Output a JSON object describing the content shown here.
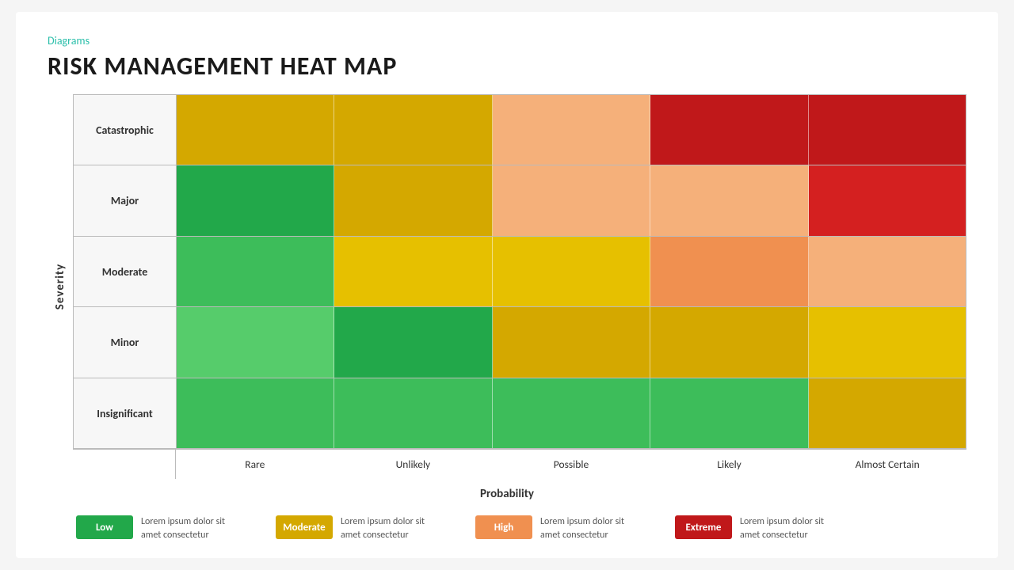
{
  "header": {
    "diagrams_label": "Diagrams",
    "title": "RISK MANAGEMENT HEAT MAP"
  },
  "matrix": {
    "severity_label": "Severity",
    "probability_label": "Probability",
    "rows": [
      {
        "label": "Catastrophic",
        "cells": [
          {
            "color": "c-yellow"
          },
          {
            "color": "c-yellow"
          },
          {
            "color": "c-orange-light"
          },
          {
            "color": "c-red-dark"
          },
          {
            "color": "c-red-dark"
          }
        ]
      },
      {
        "label": "Major",
        "cells": [
          {
            "color": "c-green-dark"
          },
          {
            "color": "c-yellow"
          },
          {
            "color": "c-orange-light"
          },
          {
            "color": "c-orange-light"
          },
          {
            "color": "c-red"
          }
        ]
      },
      {
        "label": "Moderate",
        "cells": [
          {
            "color": "c-green-mid"
          },
          {
            "color": "c-yellow-light"
          },
          {
            "color": "c-yellow-light"
          },
          {
            "color": "c-orange"
          },
          {
            "color": "c-orange-light"
          }
        ]
      },
      {
        "label": "Minor",
        "cells": [
          {
            "color": "c-green-light"
          },
          {
            "color": "c-green-dark"
          },
          {
            "color": "c-yellow"
          },
          {
            "color": "c-yellow"
          },
          {
            "color": "c-yellow-light"
          }
        ]
      },
      {
        "label": "Insignificant",
        "cells": [
          {
            "color": "c-green-mid"
          },
          {
            "color": "c-green-mid"
          },
          {
            "color": "c-green-mid"
          },
          {
            "color": "c-green-mid"
          },
          {
            "color": "c-yellow"
          }
        ]
      }
    ],
    "col_headers": [
      "Rare",
      "Unlikely",
      "Possible",
      "Likely",
      "Almost Certain"
    ]
  },
  "legend": [
    {
      "badge_label": "Low",
      "badge_color": "#22a84a",
      "description": "Lorem ipsum dolor sit amet consectetur"
    },
    {
      "badge_label": "Moderate",
      "badge_color": "#d4a800",
      "description": "Lorem ipsum dolor sit amet consectetur"
    },
    {
      "badge_label": "High",
      "badge_color": "#f09050",
      "description": "Lorem ipsum dolor sit amet consectetur"
    },
    {
      "badge_label": "Extreme",
      "badge_color": "#c0181a",
      "description": "Lorem ipsum dolor sit amet consectetur"
    }
  ]
}
